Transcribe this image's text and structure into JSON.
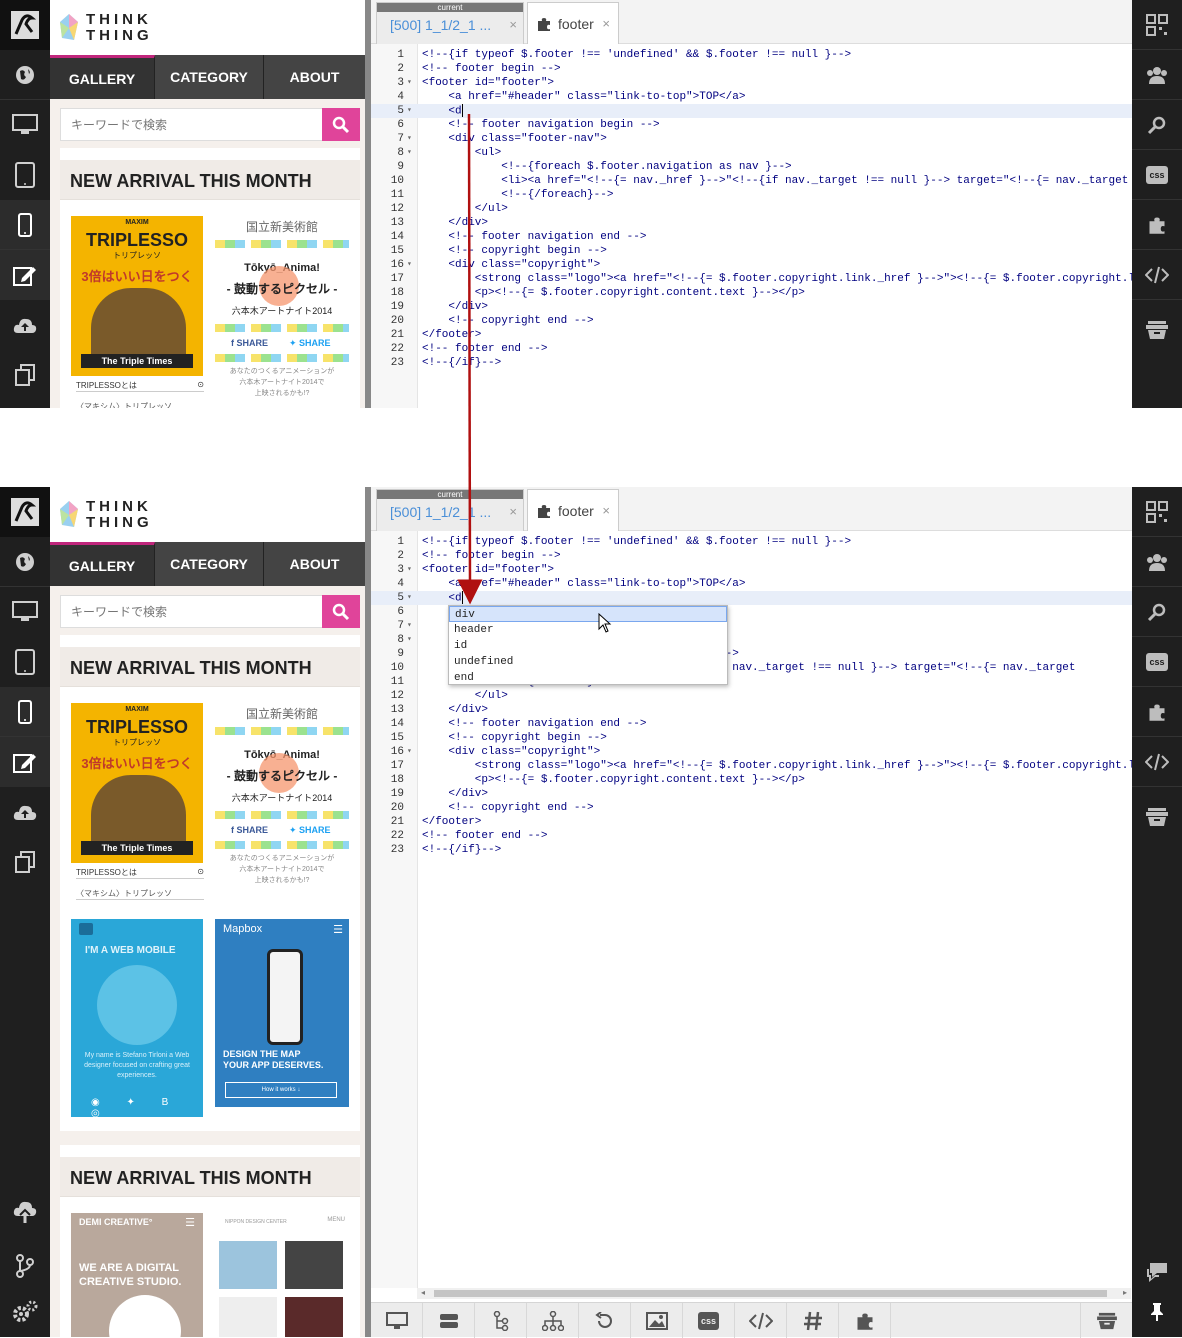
{
  "preview": {
    "brand": "THINK\nTHING",
    "nav": [
      "GALLERY",
      "CATEGORY",
      "ABOUT"
    ],
    "search_placeholder": "キーワードで検索",
    "section_title": "NEW ARRIVAL THIS MONTH",
    "cards": {
      "triplesso_brand": "MAXIM",
      "triplesso_title": "TRIPLESSO",
      "triplesso_sub": "トリプレッソ",
      "triplesso_tag": "3倍はいい日をつくる。",
      "triplesso_band": "The Triple Times",
      "triplesso_caption": "TRIPLESSOとは",
      "triplesso_caption2": "〈マキシム〉トリプレッソ",
      "anime_head": "国立新美術館",
      "anime_l1": "Tōkyō_Anima!",
      "anime_l2": "- 鼓動するピクセル -",
      "anime_l3": "六本木アートナイト2014",
      "anime_share1": "SHARE",
      "anime_share2": "SHARE",
      "anime_foot": "あなたのつくるアニメーションが\n六本木アートナイト2014で\n上映されるかも!?",
      "web_title": "I'M A WEB MOBILE",
      "web_desc": "My name is Stefano Tirloni a Web designer focused on crafting great experiences.",
      "mapbox_title": "Mapbox",
      "mapbox_desc": "DESIGN THE MAP\nYOUR APP DESERVES.",
      "mapbox_btn": "How it works ↓",
      "demi_title": "DEMI CREATIVE°",
      "demi_desc": "WE ARE A DIGITAL\nCREATIVE STUDIO.",
      "nippon_title": "NIPPON DESIGN CENTER",
      "nippon_menu": "MENU"
    }
  },
  "tabs": {
    "current_badge": "current",
    "tab1_label": "[500] 1_1/2_1 ...",
    "tab2_label": "footer",
    "close": "×"
  },
  "editor_lines": [
    {
      "n": "1",
      "fold": "",
      "code": "<!--{if typeof $.footer !== 'undefined' && $.footer !== null }-->"
    },
    {
      "n": "2",
      "fold": "",
      "code": "<!-- footer begin -->"
    },
    {
      "n": "3",
      "fold": "▾",
      "code": "<footer id=\"footer\">"
    },
    {
      "n": "4",
      "fold": "",
      "code": "    <a href=\"#header\" class=\"link-to-top\">TOP</a>"
    },
    {
      "n": "5",
      "fold": "▾",
      "code": "    <d"
    },
    {
      "n": "6",
      "fold": "",
      "code": "    <!-- footer navigation begin -->"
    },
    {
      "n": "7",
      "fold": "▾",
      "code": "    <div class=\"footer-nav\">"
    },
    {
      "n": "8",
      "fold": "▾",
      "code": "        <ul>"
    },
    {
      "n": "9",
      "fold": "",
      "code": "            <!--{foreach $.footer.navigation as nav }-->"
    },
    {
      "n": "10",
      "fold": "",
      "code": "            <li><a href=\"<!--{= nav._href }-->\"<!--{if nav._target !== null }--> target=\"<!--{= nav._target"
    },
    {
      "n": "11",
      "fold": "",
      "code": "            <!--{/foreach}-->"
    },
    {
      "n": "12",
      "fold": "",
      "code": "        </ul>"
    },
    {
      "n": "13",
      "fold": "",
      "code": "    </div>"
    },
    {
      "n": "14",
      "fold": "",
      "code": "    <!-- footer navigation end -->"
    },
    {
      "n": "15",
      "fold": "",
      "code": "    <!-- copyright begin -->"
    },
    {
      "n": "16",
      "fold": "▾",
      "code": "    <div class=\"copyright\">"
    },
    {
      "n": "17",
      "fold": "",
      "code": "        <strong class=\"logo\"><a href=\"<!--{= $.footer.copyright.link._href }-->\"><!--{= $.footer.copyright.l"
    },
    {
      "n": "18",
      "fold": "",
      "code": "        <p><!--{= $.footer.copyright.content.text }--></p>"
    },
    {
      "n": "19",
      "fold": "",
      "code": "    </div>"
    },
    {
      "n": "20",
      "fold": "",
      "code": "    <!-- copyright end -->"
    },
    {
      "n": "21",
      "fold": "",
      "code": "</footer>"
    },
    {
      "n": "22",
      "fold": "",
      "code": "<!-- footer end -->"
    },
    {
      "n": "23",
      "fold": "",
      "code": "<!--{/if}-->"
    }
  ],
  "editor_lines_after": {
    "l9": "                                      s nav }-->",
    "l10": "                                      \"<!--{if nav._target !== null }--> target=\"<!--{= nav._target",
    "l11": "            <!--{/foreach}-->"
  },
  "autocomplete": [
    "div",
    "header",
    "id",
    "undefined",
    "end"
  ],
  "colors": {
    "accent_pink": "#e0449a",
    "tab_blue": "#4a8fd8",
    "arrow_red": "#b01010",
    "sidebar_dark": "#1f1f1f"
  },
  "icons": {
    "left_sidebar": [
      "app-logo-icon",
      "globe-icon",
      "desktop-icon",
      "tablet-icon",
      "mobile-icon",
      "edit-icon",
      "cloud-upload-icon",
      "copy-icon"
    ],
    "left_sidebar_bottom": [
      "upload-icon",
      "branch-icon",
      "settings-icon"
    ],
    "right_sidebar": [
      "qr-code-icon",
      "users-icon",
      "search-icon",
      "css-icon",
      "puzzle-icon",
      "code-icon",
      "archive-icon"
    ],
    "right_sidebar_bottom": [
      "chat-icon",
      "pin-icon"
    ],
    "toolbar": [
      "desktop-icon",
      "layout-icon",
      "tree-icon",
      "sitemap-icon",
      "refresh-icon",
      "image-icon",
      "css-icon",
      "code-icon",
      "hash-icon",
      "puzzle-icon"
    ],
    "toolbar_right": "archive-icon",
    "css_glyph": "css"
  }
}
